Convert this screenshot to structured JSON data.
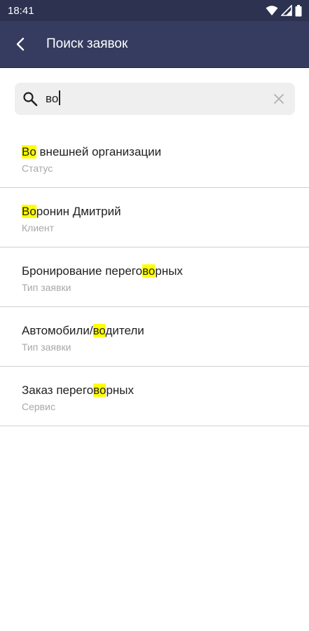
{
  "status_bar": {
    "time": "18:41"
  },
  "header": {
    "title": "Поиск заявок"
  },
  "search": {
    "value": "во"
  },
  "results": [
    {
      "before": "",
      "match": "Во",
      "after": " внешней организации",
      "subtitle": "Статус"
    },
    {
      "before": "",
      "match": "Во",
      "after": "ронин Дмитрий",
      "subtitle": "Клиент"
    },
    {
      "before": "Бронирование перего",
      "match": "во",
      "after": "рных",
      "subtitle": "Тип заявки"
    },
    {
      "before": "Автомобили/",
      "match": "во",
      "after": "дители",
      "subtitle": "Тип заявки"
    },
    {
      "before": "Заказ перего",
      "match": "во",
      "after": "рных",
      "subtitle": "Сервис"
    }
  ],
  "colors": {
    "app_bar": "#353c60",
    "status_bar": "#2c3250",
    "highlight": "#ffff00"
  },
  "icons": [
    "wifi-icon",
    "signal-icon",
    "battery-icon",
    "back-arrow-icon",
    "search-icon",
    "close-icon"
  ]
}
